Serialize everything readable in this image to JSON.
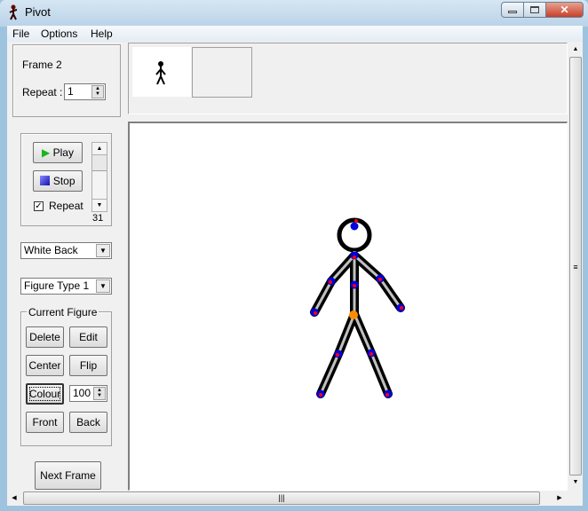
{
  "window": {
    "title": "Pivot",
    "app_icon": "stick-figure-icon"
  },
  "menu": [
    "File",
    "Options",
    "Help"
  ],
  "frame_panel": {
    "frame_label": "Frame 2",
    "repeat_label": "Repeat :",
    "repeat_value": "1"
  },
  "playback": {
    "play": "Play",
    "stop": "Stop",
    "repeat_label": "Repeat",
    "repeat_checked": true,
    "speed_value": "31"
  },
  "background_select": "White Back",
  "figure_type_select": "Figure Type 1",
  "current_figure": {
    "title": "Current Figure",
    "delete": "Delete",
    "edit": "Edit",
    "center": "Center",
    "flip": "Flip",
    "colour": "Colour",
    "opacity_value": "100",
    "front": "Front",
    "back": "Back"
  },
  "next_frame": "Next Frame",
  "colors": {
    "joint": "#0000e0",
    "joint_center": "#ff0000",
    "origin": "#ff8c00",
    "limb": "#000000",
    "limb_highlight": "#c0c0c0"
  }
}
